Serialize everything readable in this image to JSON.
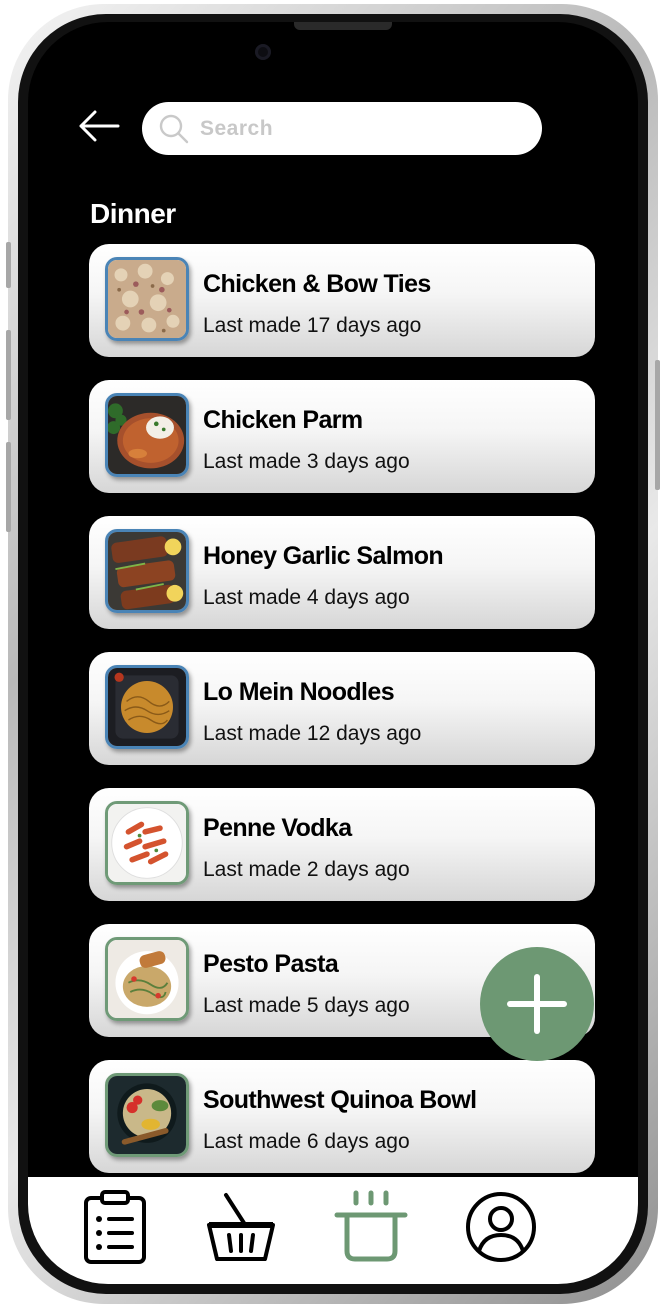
{
  "search": {
    "placeholder": "Search"
  },
  "section_title": "Dinner",
  "recipes": [
    {
      "name": "Chicken & Bow Ties",
      "last_made": "Last made 17 days ago"
    },
    {
      "name": "Chicken Parm",
      "last_made": "Last made 3 days ago"
    },
    {
      "name": "Honey Garlic Salmon",
      "last_made": "Last made 4 days ago"
    },
    {
      "name": "Lo Mein Noodles",
      "last_made": "Last made 12 days ago"
    },
    {
      "name": "Penne Vodka",
      "last_made": "Last made 2 days ago"
    },
    {
      "name": "Pesto Pasta",
      "last_made": "Last made 5 days ago"
    },
    {
      "name": "Southwest Quinoa Bowl",
      "last_made": "Last made 6 days ago"
    }
  ],
  "tabs": [
    {
      "icon": "clipboard-list-icon",
      "active": false
    },
    {
      "icon": "shopping-basket-icon",
      "active": false
    },
    {
      "icon": "cooking-pot-icon",
      "active": true
    },
    {
      "icon": "user-profile-icon",
      "active": false
    }
  ],
  "colors": {
    "accent_green": "#6d9873",
    "thumb_border_blue": "#4a84b6",
    "thumb_border_green": "#6f9a77",
    "background": "#000000"
  }
}
